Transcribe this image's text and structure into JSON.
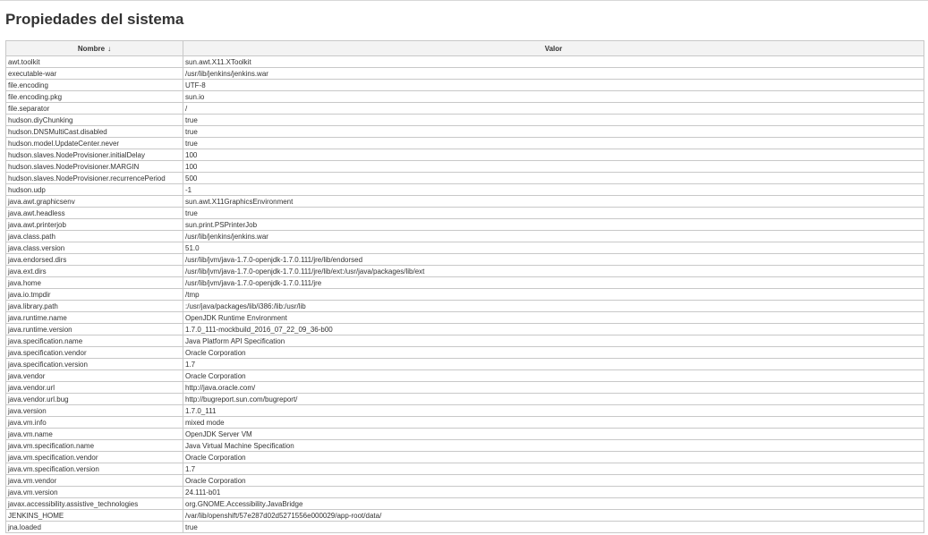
{
  "page": {
    "title": "Propiedades del sistema"
  },
  "table": {
    "headers": {
      "name": "Nombre",
      "sort_indicator": "↓",
      "value": "Valor"
    },
    "rows": [
      [
        "awt.toolkit",
        "sun.awt.X11.XToolkit"
      ],
      [
        "executable-war",
        "/usr/lib/jenkins/jenkins.war"
      ],
      [
        "file.encoding",
        "UTF-8"
      ],
      [
        "file.encoding.pkg",
        "sun.io"
      ],
      [
        "file.separator",
        "/"
      ],
      [
        "hudson.diyChunking",
        "true"
      ],
      [
        "hudson.DNSMultiCast.disabled",
        "true"
      ],
      [
        "hudson.model.UpdateCenter.never",
        "true"
      ],
      [
        "hudson.slaves.NodeProvisioner.initialDelay",
        "100"
      ],
      [
        "hudson.slaves.NodeProvisioner.MARGIN",
        "100"
      ],
      [
        "hudson.slaves.NodeProvisioner.recurrencePeriod",
        "500"
      ],
      [
        "hudson.udp",
        "-1"
      ],
      [
        "java.awt.graphicsenv",
        "sun.awt.X11GraphicsEnvironment"
      ],
      [
        "java.awt.headless",
        "true"
      ],
      [
        "java.awt.printerjob",
        "sun.print.PSPrinterJob"
      ],
      [
        "java.class.path",
        "/usr/lib/jenkins/jenkins.war"
      ],
      [
        "java.class.version",
        "51.0"
      ],
      [
        "java.endorsed.dirs",
        "/usr/lib/jvm/java-1.7.0-openjdk-1.7.0.111/jre/lib/endorsed"
      ],
      [
        "java.ext.dirs",
        "/usr/lib/jvm/java-1.7.0-openjdk-1.7.0.111/jre/lib/ext:/usr/java/packages/lib/ext"
      ],
      [
        "java.home",
        "/usr/lib/jvm/java-1.7.0-openjdk-1.7.0.111/jre"
      ],
      [
        "java.io.tmpdir",
        "/tmp"
      ],
      [
        "java.library.path",
        ":/usr/java/packages/lib/i386:/lib:/usr/lib"
      ],
      [
        "java.runtime.name",
        "OpenJDK Runtime Environment"
      ],
      [
        "java.runtime.version",
        "1.7.0_111-mockbuild_2016_07_22_09_36-b00"
      ],
      [
        "java.specification.name",
        "Java Platform API Specification"
      ],
      [
        "java.specification.vendor",
        "Oracle Corporation"
      ],
      [
        "java.specification.version",
        "1.7"
      ],
      [
        "java.vendor",
        "Oracle Corporation"
      ],
      [
        "java.vendor.url",
        "http://java.oracle.com/"
      ],
      [
        "java.vendor.url.bug",
        "http://bugreport.sun.com/bugreport/"
      ],
      [
        "java.version",
        "1.7.0_111"
      ],
      [
        "java.vm.info",
        "mixed mode"
      ],
      [
        "java.vm.name",
        "OpenJDK Server VM"
      ],
      [
        "java.vm.specification.name",
        "Java Virtual Machine Specification"
      ],
      [
        "java.vm.specification.vendor",
        "Oracle Corporation"
      ],
      [
        "java.vm.specification.version",
        "1.7"
      ],
      [
        "java.vm.vendor",
        "Oracle Corporation"
      ],
      [
        "java.vm.version",
        "24.111-b01"
      ],
      [
        "javax.accessibility.assistive_technologies",
        "org.GNOME.Accessibility.JavaBridge"
      ],
      [
        "JENKINS_HOME",
        "/var/lib/openshift/57e287d02d5271556e000029/app-root/data/"
      ],
      [
        "jna.loaded",
        "true"
      ]
    ]
  },
  "colors": {
    "text": "#333333",
    "border": "#c8c8c8",
    "header_bg": "#f3f3f3"
  }
}
